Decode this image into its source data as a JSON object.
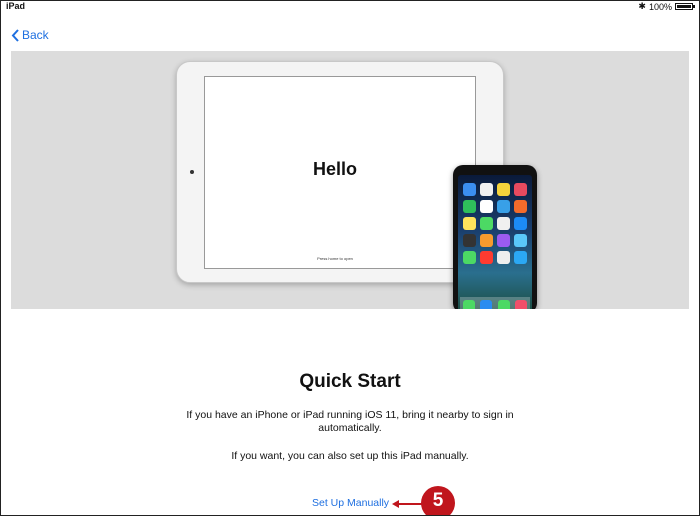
{
  "statusbar": {
    "device": "iPad",
    "battery": "100%",
    "battery_level": 1.0,
    "bluetooth_icon": "bluetooth-icon"
  },
  "nav": {
    "back_label": "Back",
    "back_icon": "chevron-left-icon"
  },
  "hero": {
    "ipad_text": "Hello",
    "ipad_subtext": "Press home to open"
  },
  "content": {
    "title": "Quick Start",
    "description": "If you have an iPhone or iPad running iOS 11, bring it nearby to sign in automatically.",
    "description2": "If you want, you can also set up this iPad manually.",
    "manual_link": "Set Up Manually"
  },
  "callout": {
    "number": "5",
    "color": "#c0161d"
  },
  "colors": {
    "accent": "#1e6fe0",
    "hero_bg": "#dcdcdc"
  }
}
